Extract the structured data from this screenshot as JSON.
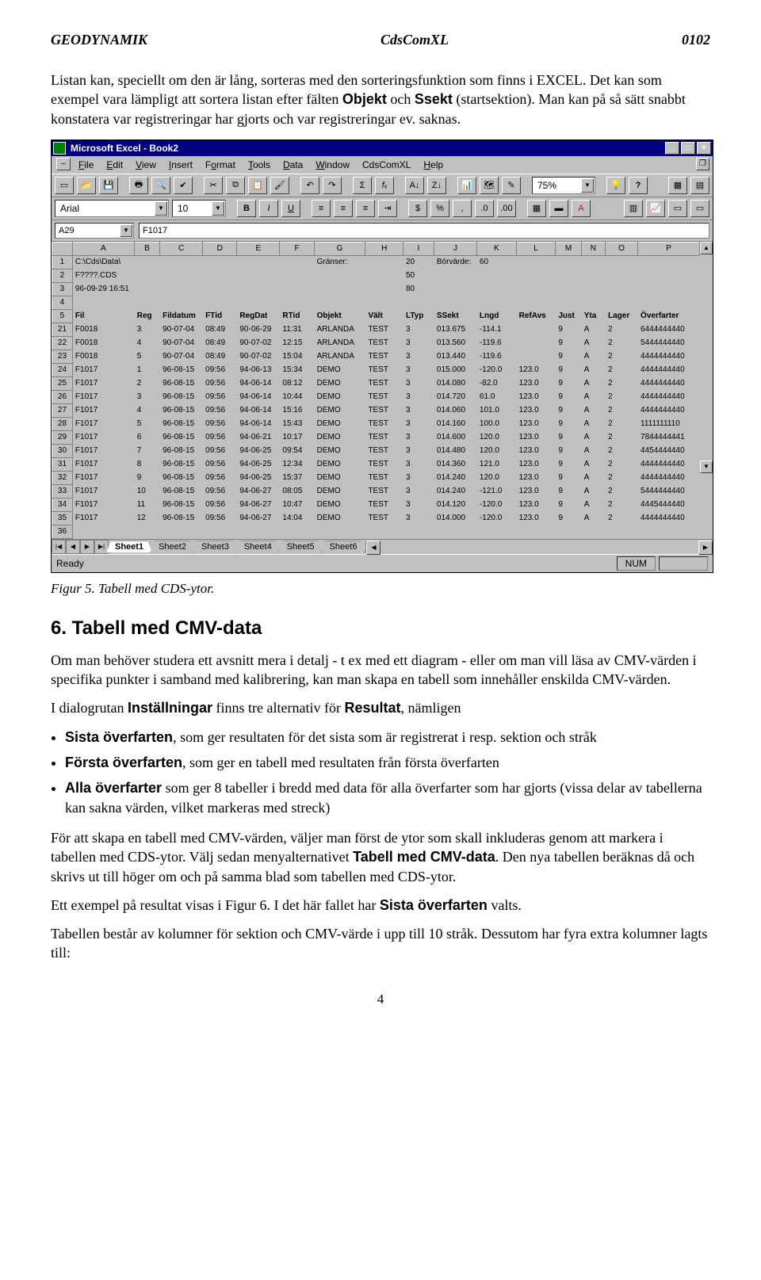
{
  "header": {
    "left": "GEODYNAMIK",
    "center": "CdsComXL",
    "right": "0102"
  },
  "para1_a": "Listan kan, speciellt om den är lång, sorteras med den sorteringsfunktion som finns i EXCEL. Det kan som exempel vara lämpligt att sortera listan efter fälten ",
  "para1_b": "Objekt",
  "para1_c": " och ",
  "para1_d": "Ssekt",
  "para1_e": " (startsektion). Man kan på så sätt snabbt konstatera var registreringar har gjorts och var registreringar ev. saknas.",
  "excel": {
    "title": "Microsoft Excel - Book2",
    "menus": [
      "File",
      "Edit",
      "View",
      "Insert",
      "Format",
      "Tools",
      "Data",
      "Window",
      "CdsComXL",
      "Help"
    ],
    "zoom": "75%",
    "font": "Arial",
    "fontsize": "10",
    "namebox": "A29",
    "formula": "F1017",
    "col_letters": [
      "A",
      "B",
      "C",
      "D",
      "E",
      "F",
      "G",
      "H",
      "I",
      "J",
      "K",
      "L",
      "M",
      "N",
      "O",
      "P"
    ],
    "top_rows": [
      {
        "n": "1",
        "cells": [
          "C:\\Cds\\Data\\",
          "",
          "",
          "",
          "",
          "",
          "Gränser:",
          "",
          "20",
          "Börvärde:",
          "60",
          "",
          "",
          "",
          "",
          ""
        ]
      },
      {
        "n": "2",
        "cells": [
          "F????.CDS",
          "",
          "",
          "",
          "",
          "",
          "",
          "",
          "50",
          "",
          "",
          "",
          "",
          "",
          "",
          ""
        ]
      },
      {
        "n": "3",
        "cells": [
          "96-09-29 16:51",
          "",
          "",
          "",
          "",
          "",
          "",
          "",
          "80",
          "",
          "",
          "",
          "",
          "",
          "",
          ""
        ]
      },
      {
        "n": "4",
        "cells": [
          "",
          "",
          "",
          "",
          "",
          "",
          "",
          "",
          "",
          "",
          "",
          "",
          "",
          "",
          "",
          ""
        ]
      }
    ],
    "field_header_row": {
      "n": "5",
      "cells": [
        "Fil",
        "Reg",
        "Fildatum",
        "FTid",
        "RegDat",
        "RTid",
        "Objekt",
        "Vält",
        "LTyp",
        "SSekt",
        "Lngd",
        "RefAvs",
        "Just",
        "Yta",
        "Lager",
        "Överfarter"
      ]
    },
    "data_rows": [
      {
        "n": "21",
        "cells": [
          "F0018",
          "3",
          "90-07-04",
          "08:49",
          "90-06-29",
          "11:31",
          "ARLANDA",
          "TEST",
          "3",
          "013.675",
          "-114.1",
          "",
          "9",
          "A",
          "2",
          "6444444440"
        ]
      },
      {
        "n": "22",
        "cells": [
          "F0018",
          "4",
          "90-07-04",
          "08:49",
          "90-07-02",
          "12:15",
          "ARLANDA",
          "TEST",
          "3",
          "013.560",
          "-119.6",
          "",
          "9",
          "A",
          "2",
          "5444444440"
        ]
      },
      {
        "n": "23",
        "cells": [
          "F0018",
          "5",
          "90-07-04",
          "08:49",
          "90-07-02",
          "15:04",
          "ARLANDA",
          "TEST",
          "3",
          "013.440",
          "-119.6",
          "",
          "9",
          "A",
          "2",
          "4444444440"
        ]
      },
      {
        "n": "24",
        "cells": [
          "F1017",
          "1",
          "96-08-15",
          "09:56",
          "94-06-13",
          "15:34",
          "DEMO",
          "TEST",
          "3",
          "015.000",
          "-120.0",
          "123.0",
          "9",
          "A",
          "2",
          "4444444440"
        ]
      },
      {
        "n": "25",
        "cells": [
          "F1017",
          "2",
          "96-08-15",
          "09:56",
          "94-06-14",
          "08:12",
          "DEMO",
          "TEST",
          "3",
          "014.080",
          "-82.0",
          "123.0",
          "9",
          "A",
          "2",
          "4444444440"
        ]
      },
      {
        "n": "26",
        "cells": [
          "F1017",
          "3",
          "96-08-15",
          "09:56",
          "94-06-14",
          "10:44",
          "DEMO",
          "TEST",
          "3",
          "014.720",
          "61.0",
          "123.0",
          "9",
          "A",
          "2",
          "4444444440"
        ]
      },
      {
        "n": "27",
        "cells": [
          "F1017",
          "4",
          "96-08-15",
          "09:56",
          "94-06-14",
          "15:16",
          "DEMO",
          "TEST",
          "3",
          "014.060",
          "101.0",
          "123.0",
          "9",
          "A",
          "2",
          "4444444440"
        ]
      },
      {
        "n": "28",
        "cells": [
          "F1017",
          "5",
          "96-08-15",
          "09:56",
          "94-06-14",
          "15:43",
          "DEMO",
          "TEST",
          "3",
          "014.160",
          "100.0",
          "123.0",
          "9",
          "A",
          "2",
          "1111111110"
        ]
      },
      {
        "n": "29",
        "cells": [
          "F1017",
          "6",
          "96-08-15",
          "09:56",
          "94-06-21",
          "10:17",
          "DEMO",
          "TEST",
          "3",
          "014.600",
          "120.0",
          "123.0",
          "9",
          "A",
          "2",
          "7844444441"
        ]
      },
      {
        "n": "30",
        "cells": [
          "F1017",
          "7",
          "96-08-15",
          "09:56",
          "94-06-25",
          "09:54",
          "DEMO",
          "TEST",
          "3",
          "014.480",
          "120.0",
          "123.0",
          "9",
          "A",
          "2",
          "4454444440"
        ]
      },
      {
        "n": "31",
        "cells": [
          "F1017",
          "8",
          "96-08-15",
          "09:56",
          "94-06-25",
          "12:34",
          "DEMO",
          "TEST",
          "3",
          "014.360",
          "121.0",
          "123.0",
          "9",
          "A",
          "2",
          "4444444440"
        ]
      },
      {
        "n": "32",
        "cells": [
          "F1017",
          "9",
          "96-08-15",
          "09:56",
          "94-06-25",
          "15:37",
          "DEMO",
          "TEST",
          "3",
          "014.240",
          "120.0",
          "123.0",
          "9",
          "A",
          "2",
          "4444444440"
        ]
      },
      {
        "n": "33",
        "cells": [
          "F1017",
          "10",
          "96-08-15",
          "09:56",
          "94-06-27",
          "08:05",
          "DEMO",
          "TEST",
          "3",
          "014.240",
          "-121.0",
          "123.0",
          "9",
          "A",
          "2",
          "5444444440"
        ]
      },
      {
        "n": "34",
        "cells": [
          "F1017",
          "11",
          "96-08-15",
          "09:56",
          "94-06-27",
          "10:47",
          "DEMO",
          "TEST",
          "3",
          "014.120",
          "-120.0",
          "123.0",
          "9",
          "A",
          "2",
          "4445444440"
        ]
      },
      {
        "n": "35",
        "cells": [
          "F1017",
          "12",
          "96-08-15",
          "09:56",
          "94-06-27",
          "14:04",
          "DEMO",
          "TEST",
          "3",
          "014.000",
          "-120.0",
          "123.0",
          "9",
          "A",
          "2",
          "4444444440"
        ]
      },
      {
        "n": "36",
        "cells": [
          "",
          "",
          "",
          "",
          "",
          "",
          "",
          "",
          "",
          "",
          "",
          "",
          "",
          "",
          "",
          ""
        ]
      }
    ],
    "tabs": [
      "Sheet1",
      "Sheet2",
      "Sheet3",
      "Sheet4",
      "Sheet5",
      "Sheet6"
    ],
    "status_left": "Ready",
    "status_num": "NUM"
  },
  "figcaption_a": "Figur 5. ",
  "figcaption_b": "Tabell med CDS-ytor.",
  "section_heading": "6. Tabell med CMV-data",
  "para2": "Om man behöver studera ett avsnitt mera i detalj - t ex med ett diagram - eller om man vill läsa av CMV-värden i specifika punkter i samband med kalibrering, kan man skapa en tabell som innehåller enskilda CMV-värden.",
  "para3_a": "I dialogrutan ",
  "para3_b": "Inställningar",
  "para3_c": " finns tre alternativ för ",
  "para3_d": "Resultat",
  "para3_e": ", nämligen",
  "bullet1_a": "Sista överfarten",
  "bullet1_b": ", som ger resultaten för det sista som är registrerat i resp. sektion och stråk",
  "bullet2_a": "Första överfarten",
  "bullet2_b": ", som ger en tabell med resultaten från första överfarten",
  "bullet3_a": "Alla överfarter",
  "bullet3_b": " som ger 8 tabeller i bredd med data för alla överfarter som har gjorts (vissa delar av tabellerna kan sakna värden, vilket markeras med streck)",
  "para4_a": "För att skapa en tabell med CMV-värden, väljer man först de ytor som skall inkluderas genom att markera i tabellen med CDS-ytor. Välj sedan menyalternativet ",
  "para4_b": "Tabell med CMV-data",
  "para4_c": ". Den nya tabellen beräknas då och skrivs ut till höger om och på samma blad som tabellen med CDS-ytor.",
  "para5_a": "Ett exempel på resultat visas i Figur 6. I det här fallet har ",
  "para5_b": "Sista överfarten",
  "para5_c": " valts.",
  "para6": "Tabellen består av kolumner för sektion och CMV-värde i upp till 10 stråk. Dessutom har fyra extra kolumner lagts till:",
  "page_number": "4"
}
